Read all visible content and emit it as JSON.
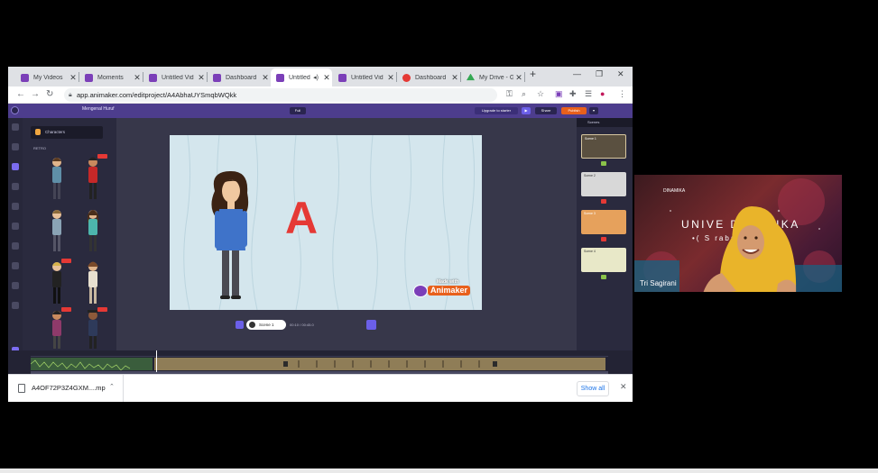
{
  "browser": {
    "tabs": [
      {
        "label": "My Videos",
        "favicon_color": "#7b3fb8"
      },
      {
        "label": "Moments",
        "favicon_color": "#7b3fb8"
      },
      {
        "label": "Untitled Vid",
        "favicon_color": "#7b3fb8"
      },
      {
        "label": "Dashboard",
        "favicon_color": "#7b3fb8"
      },
      {
        "label": "Untitled",
        "favicon_color": "#7b3fb8",
        "active": true
      },
      {
        "label": "Untitled Vid",
        "favicon_color": "#7b3fb8"
      },
      {
        "label": "Dashboard",
        "favicon_color": "#e53935"
      },
      {
        "label": "My Drive - G",
        "favicon_color": "#34a853"
      }
    ],
    "new_tab_label": "+",
    "url": "app.animaker.com/editproject/A4AbhaUYSmqbWQkk"
  },
  "app": {
    "project_name": "Mengenal Huruf",
    "header_pill_mid": "Full",
    "upgrade_label": "Upgrade to starter",
    "share_label": "Share",
    "publish_label": "Publish",
    "character_selector": "Characters",
    "section_label": "RETRO",
    "scene_pill_label": "Scene 1",
    "time_readout": "00:10 / 00:45.0",
    "right_panel_title": "Scenes",
    "scene_thumbs": [
      {
        "label": "Scene 1",
        "color": "#5a5040"
      },
      {
        "label": "Scene 2",
        "color": "#d8d8d8"
      },
      {
        "label": "Scene 3",
        "color": "#e6a15c"
      },
      {
        "label": "Scene 4",
        "color": "#e8e8c8"
      }
    ],
    "scene_tag_colors": [
      "#8bc34a",
      "#e53935",
      "#e53935",
      "#8bc34a"
    ]
  },
  "canvas": {
    "letter": "A",
    "watermark_made": "Made with",
    "watermark_brand": "Animaker"
  },
  "download": {
    "file_name": "A4OF72P3Z4GXM....mp",
    "show_all": "Show all"
  },
  "webcam": {
    "participant_name": "Tri Sagirani",
    "banner_line1": "UNIVE     DINAMIKA",
    "banner_line2": "•( S       rabaya )",
    "logo_text": "DINAMIKA"
  },
  "colors": {
    "accent": "#6b5fe8",
    "app_header": "#4d3d8d",
    "letter": "#e53935",
    "link": "#1a73e8"
  }
}
